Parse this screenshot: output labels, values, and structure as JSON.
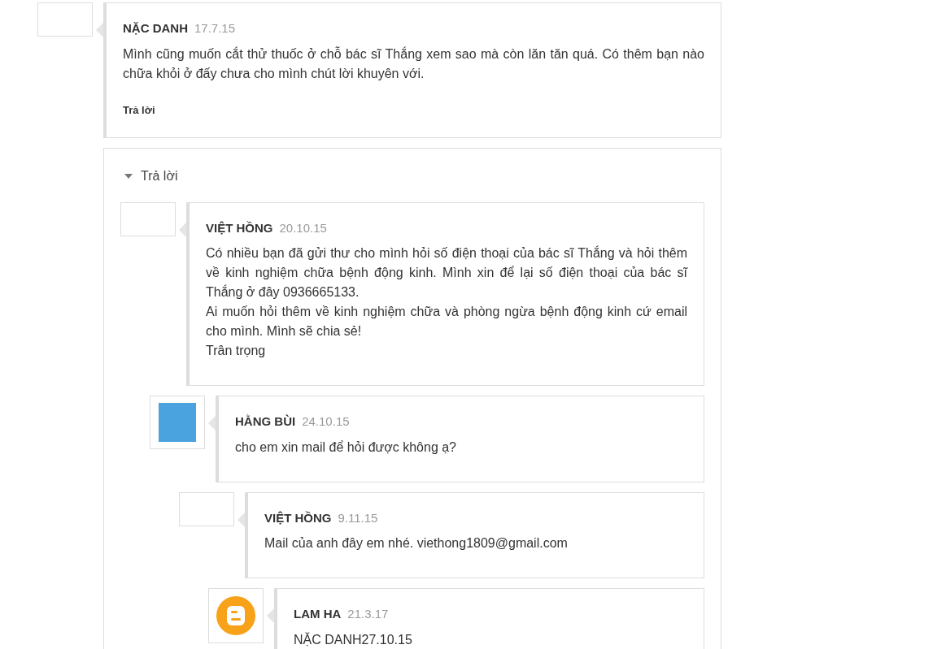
{
  "comment": {
    "author": "NẶC DANH",
    "date": "17.7.15",
    "avatar": {
      "kind": "blank"
    },
    "paragraphs": [
      "Mình cũng muốn cắt thử thuốc ở chỗ bác sĩ Thắng xem sao mà còn lăn tăn quá. Có thêm bạn nào chữa khỏi ở đấy chưa cho mình chút lời khuyên với."
    ],
    "reply_link": "Trả lời"
  },
  "replies": {
    "label": "Trả lời",
    "expanded": true,
    "items": [
      {
        "author": "VIỆT HỒNG",
        "date": "20.10.15",
        "avatar": {
          "kind": "blank"
        },
        "paragraphs": [
          "Có nhiều bạn đã gửi thư cho mình hỏi số điện thoại của bác sĩ Thắng và hỏi thêm về kinh nghiệm chữa bệnh động kinh. Mình xin để lại số điện thoại của bác sĩ Thắng ở đây 0936665133.",
          "Ai muốn hỏi thêm về kinh nghiệm chữa và phòng ngừa bệnh động kinh cứ email cho mình. Mình sẽ chia sẻ!",
          "Trân trọng"
        ],
        "children": [
          {
            "author": "HẰNG BÙI",
            "date": "24.10.15",
            "avatar": {
              "kind": "photo"
            },
            "paragraphs": [
              "cho em xin mail để hỏi được không ạ?"
            ],
            "children": [
              {
                "author": "VIỆT HỒNG",
                "date": "9.11.15",
                "avatar": {
                  "kind": "blank"
                },
                "paragraphs": [
                  "Mail của anh đây em nhé. viethong1809@gmail.com"
                ],
                "children": [
                  {
                    "author": "LAM HA",
                    "date": "21.3.17",
                    "avatar": {
                      "kind": "logo"
                    },
                    "paragraphs": [
                      "NẶC DANH27.10.15"
                    ]
                  }
                ]
              }
            ]
          }
        ]
      }
    ]
  }
}
